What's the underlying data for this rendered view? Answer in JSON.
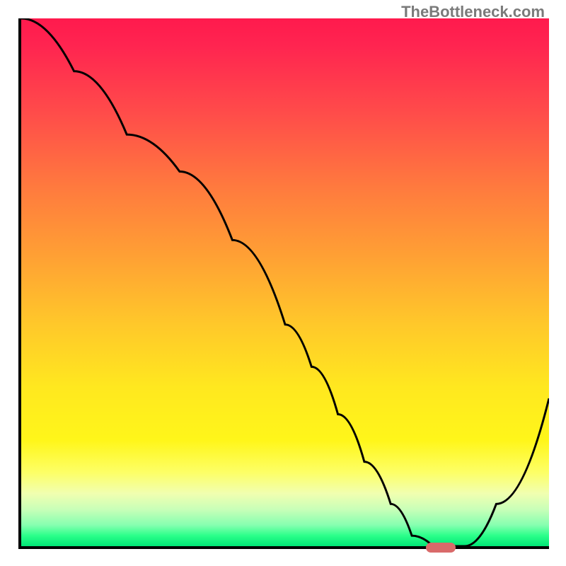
{
  "watermark": "TheBottleneck.com",
  "chart_data": {
    "type": "line",
    "title": "",
    "xlabel": "",
    "ylabel": "",
    "xlim": [
      0,
      100
    ],
    "ylim": [
      0,
      100
    ],
    "x": [
      0,
      10,
      20,
      30,
      40,
      50,
      55,
      60,
      65,
      70,
      74,
      78,
      80,
      84,
      90,
      100
    ],
    "values": [
      100,
      90,
      78,
      71,
      58,
      42,
      34,
      25,
      16,
      8,
      2,
      0,
      0,
      0,
      8,
      28
    ],
    "marker": {
      "x": 79,
      "y": 0
    },
    "gradient_stops": [
      {
        "pos": 0,
        "color": "#ff1a4d"
      },
      {
        "pos": 18,
        "color": "#ff4c4a"
      },
      {
        "pos": 45,
        "color": "#ffa034"
      },
      {
        "pos": 70,
        "color": "#ffe81f"
      },
      {
        "pos": 90,
        "color": "#f1ffb0"
      },
      {
        "pos": 100,
        "color": "#00e676"
      }
    ]
  }
}
